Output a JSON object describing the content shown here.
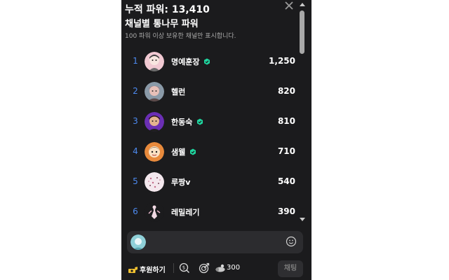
{
  "header": {
    "total_label": "누적 파워: 13,410",
    "subtitle": "채널별 통나무 파워",
    "description": "100 파워 이상 보유한 채널만 표시합니다."
  },
  "ranking": [
    {
      "rank": "1",
      "name": "명예훈장",
      "value": "1,250",
      "verified": true
    },
    {
      "rank": "2",
      "name": "헬런",
      "value": "820",
      "verified": false
    },
    {
      "rank": "3",
      "name": "한동숙",
      "value": "810",
      "verified": true
    },
    {
      "rank": "4",
      "name": "샘웰",
      "value": "710",
      "verified": true
    },
    {
      "rank": "5",
      "name": "루짱v",
      "value": "540",
      "verified": false
    },
    {
      "rank": "6",
      "name": "레밀레기",
      "value": "390",
      "verified": false
    }
  ],
  "footer": {
    "donate_label": "후원하기",
    "points": "300",
    "chat_button": "채팅"
  },
  "colors": {
    "panel_bg": "#1b1b1d",
    "rank_blue": "#4d8af0",
    "badge_green": "#1fd7a0"
  }
}
